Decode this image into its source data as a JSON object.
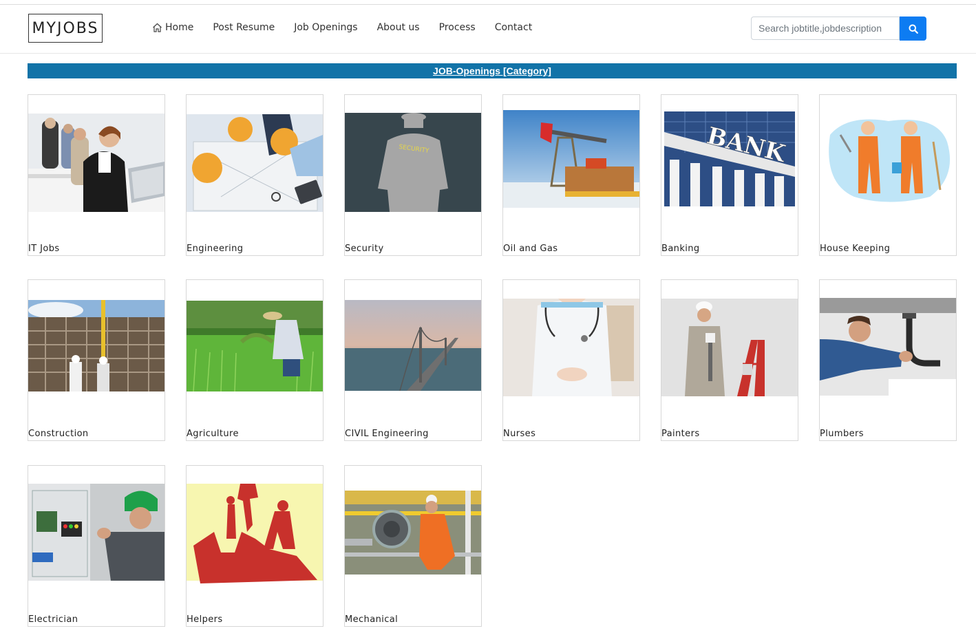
{
  "brand": {
    "logo_text": "MYJOBS"
  },
  "nav": {
    "items": [
      {
        "label": "Home",
        "icon": "home-icon"
      },
      {
        "label": "Post Resume"
      },
      {
        "label": "Job Openings"
      },
      {
        "label": "About us"
      },
      {
        "label": "Process"
      },
      {
        "label": "Contact"
      }
    ]
  },
  "search": {
    "placeholder": "Search jobtitle,jobdescription",
    "button_icon": "search-icon"
  },
  "banner": {
    "title": "JOB-Openings [Category]"
  },
  "categories": [
    {
      "label": "IT Jobs",
      "image": "office-workers-photo"
    },
    {
      "label": "Engineering",
      "image": "engineers-blueprint-photo"
    },
    {
      "label": "Security",
      "image": "security-guard-silhouette"
    },
    {
      "label": "Oil and Gas",
      "image": "oil-pump-photo"
    },
    {
      "label": "Banking",
      "image": "bank-building-photo"
    },
    {
      "label": "House Keeping",
      "image": "cleaners-illustration"
    },
    {
      "label": "Construction",
      "image": "construction-site-photo"
    },
    {
      "label": "Agriculture",
      "image": "farmer-field-photo"
    },
    {
      "label": "CIVIL Engineering",
      "image": "bridge-photo"
    },
    {
      "label": "Nurses",
      "image": "nurse-photo"
    },
    {
      "label": "Painters",
      "image": "painter-photo"
    },
    {
      "label": "Plumbers",
      "image": "plumber-photo"
    },
    {
      "label": "Electrician",
      "image": "electrician-photo"
    },
    {
      "label": "Helpers",
      "image": "workers-silhouette-illustration"
    },
    {
      "label": "Mechanical",
      "image": "mechanical-engineer-photo"
    }
  ],
  "colors": {
    "banner": "#1273a8",
    "search_button": "#0d7cf2"
  }
}
